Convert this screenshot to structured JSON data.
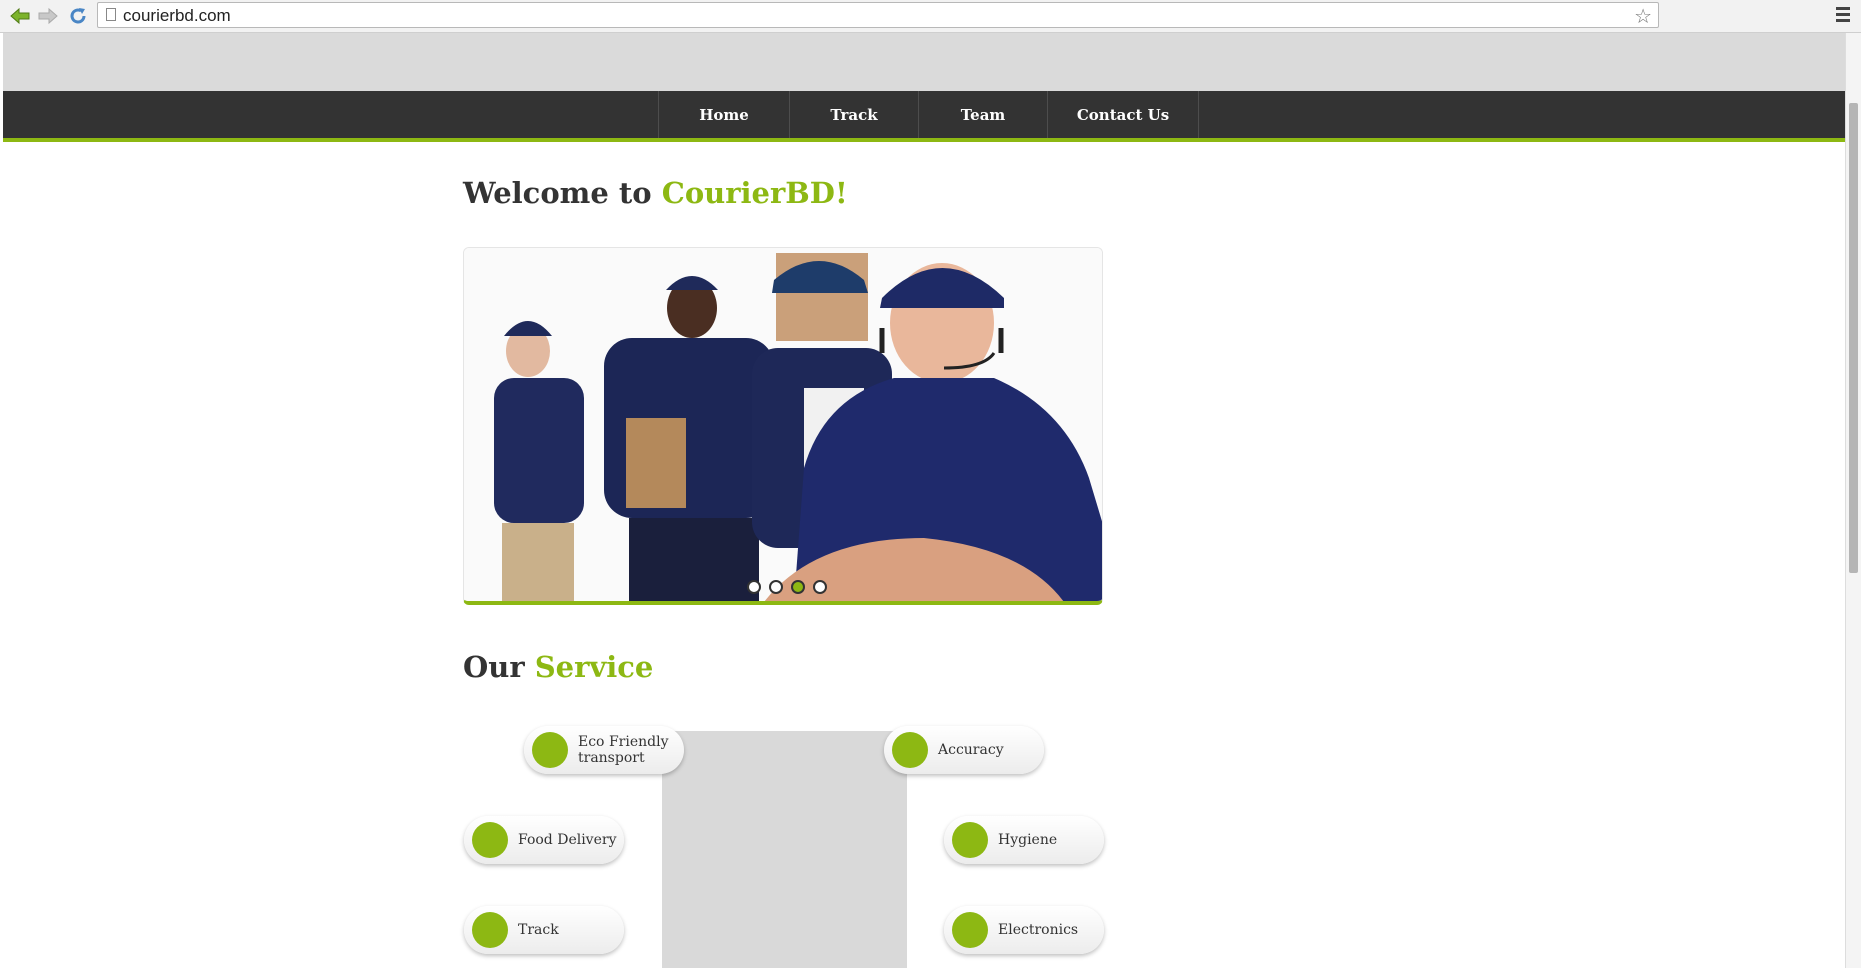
{
  "browser": {
    "url": "courierbd.com"
  },
  "nav": {
    "items": [
      "Home",
      "Track",
      "Team",
      "Contact Us"
    ]
  },
  "welcome": {
    "prefix": "Welcome to ",
    "brand": "CourierBD!"
  },
  "slider": {
    "dots": 4,
    "active_dot": 3
  },
  "service": {
    "prefix": "Our ",
    "highlight": "Service",
    "items": [
      "Eco Friendly transport",
      "Accuracy",
      "Food Delivery",
      "Hygiene",
      "Track",
      "Electronics"
    ]
  },
  "colors": {
    "accent": "#8db813",
    "navbar": "#333333"
  }
}
